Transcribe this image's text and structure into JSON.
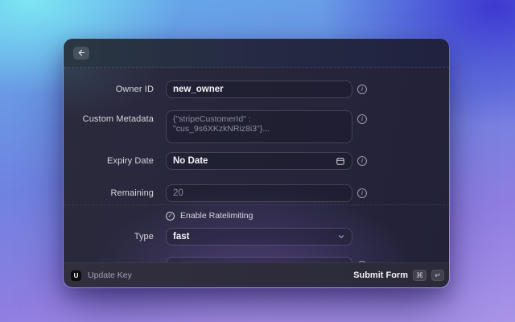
{
  "window": {
    "back_icon": "arrow-left"
  },
  "form": {
    "owner": {
      "label": "Owner ID",
      "value": "new_owner"
    },
    "metadata": {
      "label": "Custom Metadata",
      "placeholder": "{\"stripeCustomerId\" : \"cus_9s6XKzkNRiz8i3\"}..."
    },
    "expiry": {
      "label": "Expiry Date",
      "value": "No Date"
    },
    "remaining": {
      "label": "Remaining",
      "placeholder": "20"
    },
    "ratelimit": {
      "checkbox_label": "Enable Ratelimiting",
      "checked": true,
      "type_label": "Type",
      "type_value": "fast"
    }
  },
  "footer": {
    "logo_letter": "U",
    "action_label": "Update Key",
    "submit_label": "Submit Form",
    "kbd_command": "⌘",
    "kbd_enter": "↵"
  },
  "icons": {
    "info": "i",
    "check": "✓"
  },
  "colors": {
    "bg_top_left": "#7de6f1",
    "bg_top_right": "#3b33d0",
    "bg_bottom": "#a992e8",
    "modal_body": "#262438",
    "footer_bg": "#2e2c3a",
    "logo_bg": "#0b0b0e"
  }
}
